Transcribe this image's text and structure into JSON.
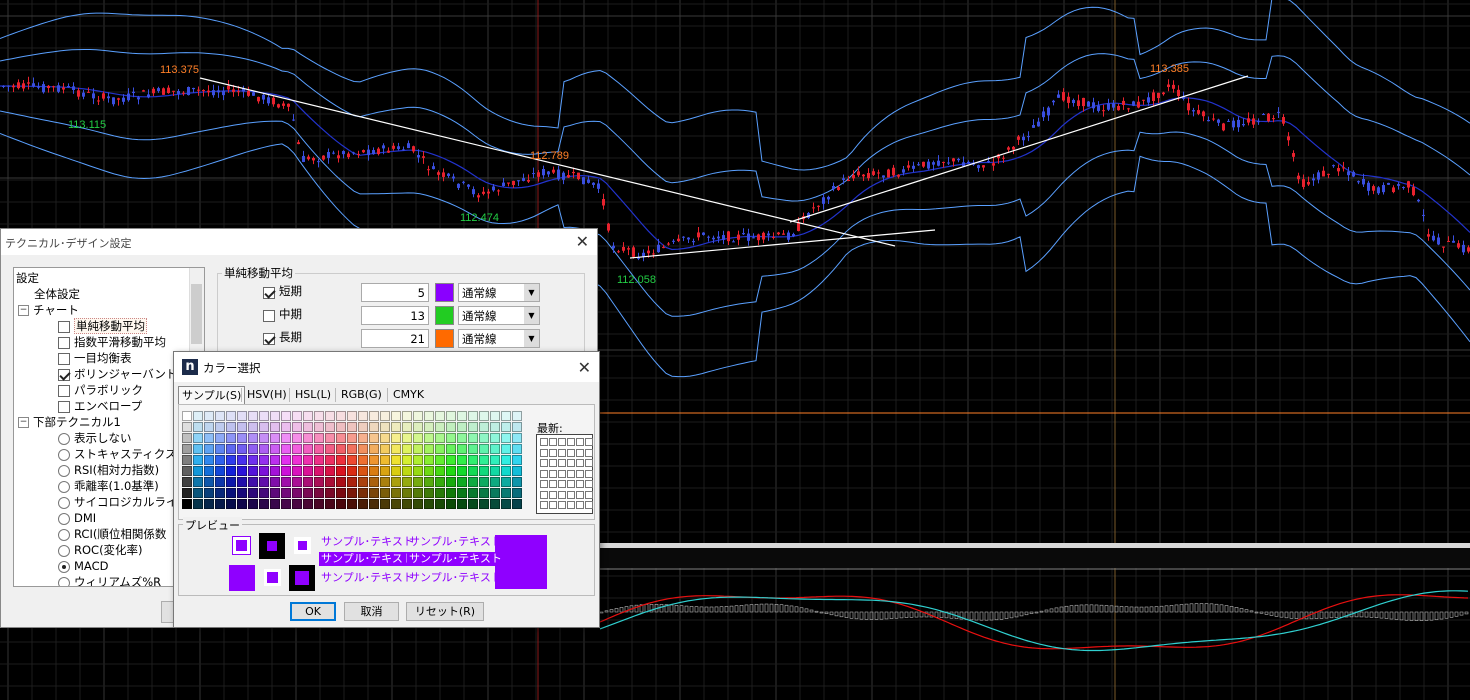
{
  "chart": {
    "price_labels": [
      {
        "text": "113.375",
        "color": "#ff7f27"
      },
      {
        "text": "113.115",
        "color": "#22cc44"
      },
      {
        "text": "112.789",
        "color": "#ff7f27"
      },
      {
        "text": "112.474",
        "color": "#22cc44"
      },
      {
        "text": "112.058",
        "color": "#22cc44"
      },
      {
        "text": "113.385",
        "color": "#ff7f27"
      }
    ],
    "colors": {
      "background": "#000000",
      "grid": "#2a2a2a",
      "up_candle": "#e8222e",
      "down_candle": "#3a4fe0",
      "band": "#5aa0ff",
      "midline": "#2233cc",
      "trendline": "#ffffff",
      "crosshair": "#ff7f27",
      "macd": "#e81010",
      "signal": "#30d0d0",
      "histogram": "#bbbbbb"
    }
  },
  "tech_dialog": {
    "title": "テクニカル･デザイン設定",
    "tree": [
      {
        "label": "設定",
        "kind": "text"
      },
      {
        "label": "全体設定",
        "kind": "text"
      },
      {
        "label": "チャート",
        "kind": "expander"
      },
      {
        "label": "単純移動平均",
        "kind": "check",
        "checked": false,
        "selected": true
      },
      {
        "label": "指数平滑移動平均",
        "kind": "check",
        "checked": false
      },
      {
        "label": "一目均衡表",
        "kind": "check",
        "checked": false
      },
      {
        "label": "ボリンジャーバンド",
        "kind": "check",
        "checked": true
      },
      {
        "label": "パラボリック",
        "kind": "check",
        "checked": false
      },
      {
        "label": "エンベロープ",
        "kind": "check",
        "checked": false
      },
      {
        "label": "下部テクニカル1",
        "kind": "expander"
      },
      {
        "label": "表示しない",
        "kind": "radio",
        "selected": false
      },
      {
        "label": "ストキャスティクス",
        "kind": "radio",
        "selected": false
      },
      {
        "label": "RSI(相対力指数)",
        "kind": "radio",
        "selected": false
      },
      {
        "label": "乖離率(1.0基準)",
        "kind": "radio",
        "selected": false
      },
      {
        "label": "サイコロジカルライン",
        "kind": "radio",
        "selected": false
      },
      {
        "label": "DMI",
        "kind": "radio",
        "selected": false
      },
      {
        "label": "RCI(順位相関係数",
        "kind": "radio",
        "selected": false
      },
      {
        "label": "ROC(変化率)",
        "kind": "radio",
        "selected": false
      },
      {
        "label": "MACD",
        "kind": "radio",
        "selected": true
      },
      {
        "label": "ウィリアムズ%R",
        "kind": "radio",
        "selected": false
      }
    ],
    "sma": {
      "title": "単純移動平均",
      "rows": [
        {
          "label": "短期",
          "checked": true,
          "value": "5",
          "color": "#8a00ff",
          "line": "通常線"
        },
        {
          "label": "中期",
          "checked": false,
          "value": "13",
          "color": "#22cc22",
          "line": "通常線"
        },
        {
          "label": "長期",
          "checked": true,
          "value": "21",
          "color": "#ff6a00",
          "line": "通常線"
        }
      ]
    }
  },
  "color_dialog": {
    "title": "カラー選択",
    "tabs": [
      "サンプル(S)",
      "HSV(H)",
      "HSL(L)",
      "RGB(G)",
      "CMYK"
    ],
    "recent_label": "最新:",
    "preview_label": "プレビュー",
    "sample_text": "サンプル･テキスト",
    "selected_color": "#8f00ff",
    "ok": "OK",
    "cancel": "取消",
    "reset": "リセット(R)"
  }
}
